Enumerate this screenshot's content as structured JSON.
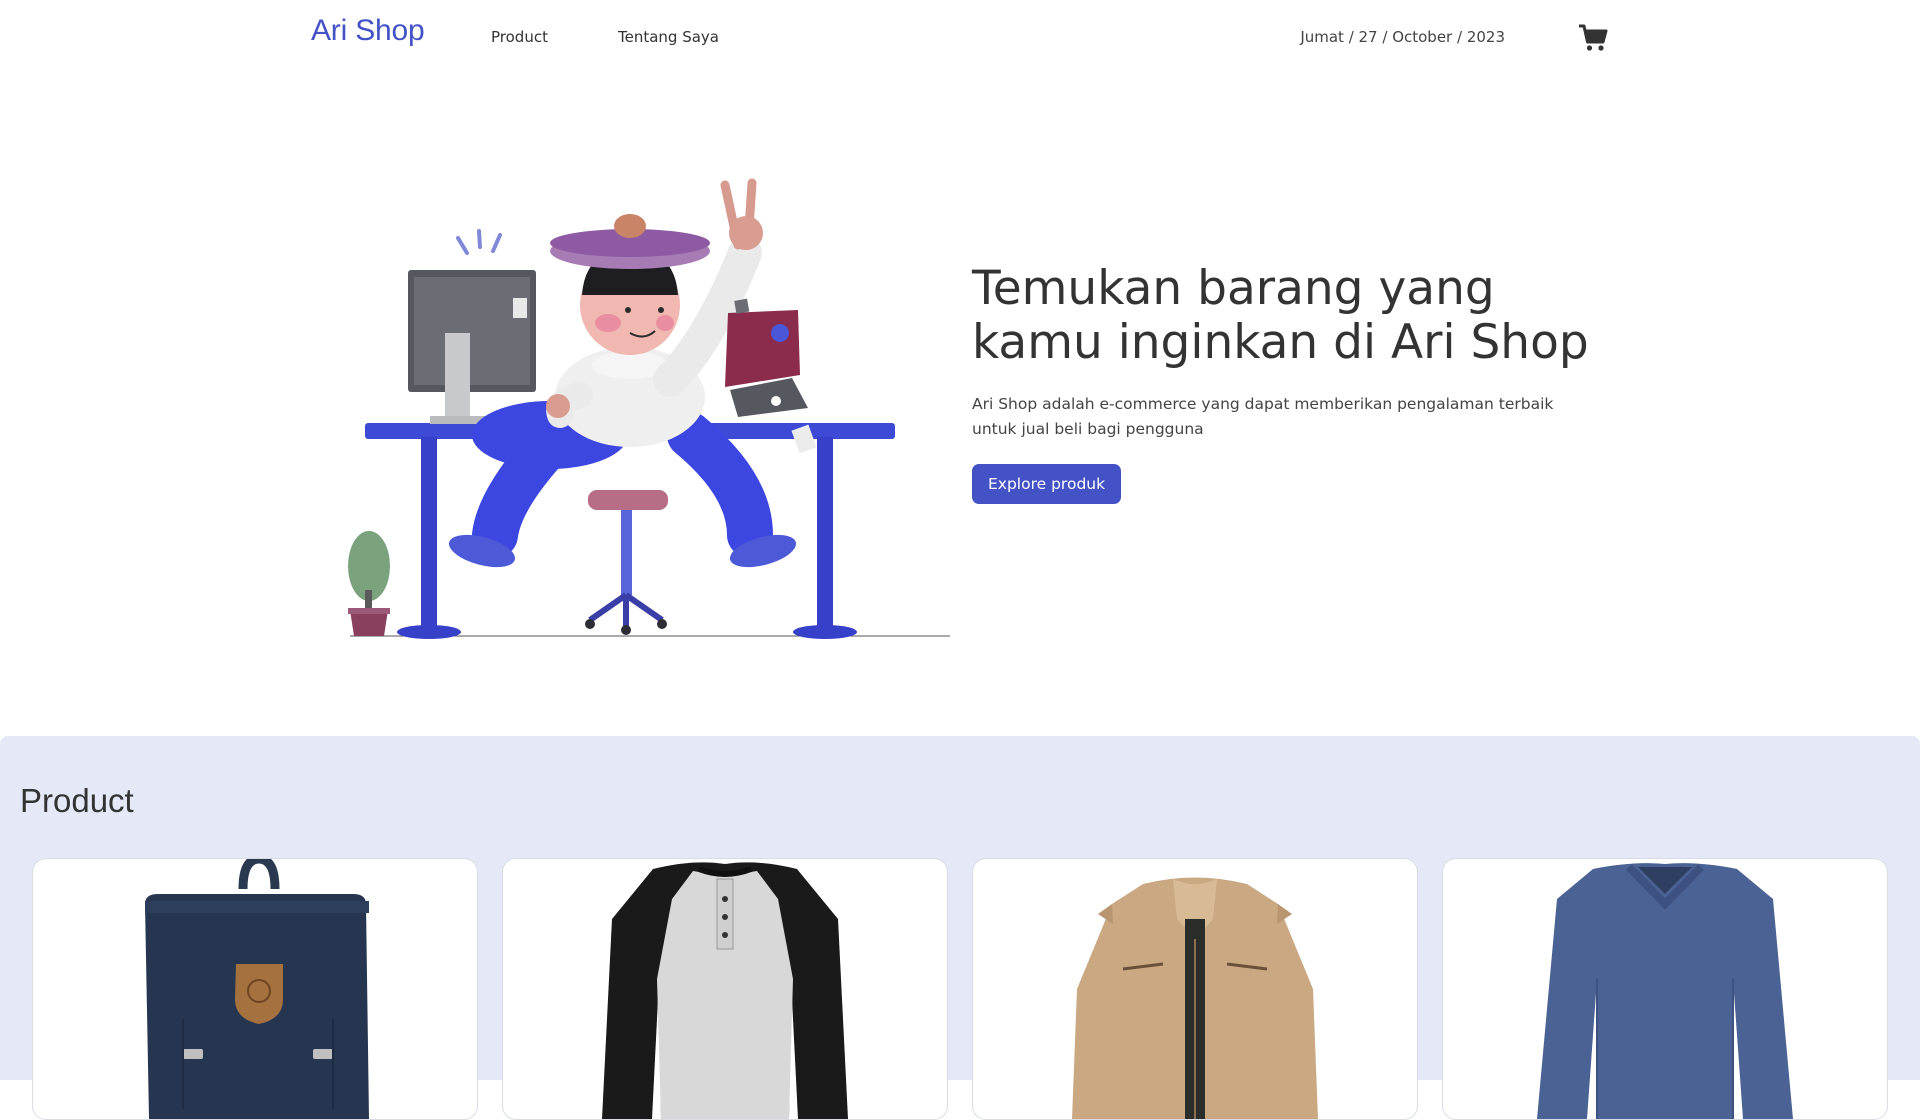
{
  "nav": {
    "brand": "Ari Shop",
    "links": [
      "Product",
      "Tentang Saya"
    ],
    "date": "Jumat / 27 / October / 2023",
    "cart_icon": "cart-icon"
  },
  "hero": {
    "title": "Temukan barang yang kamu inginkan di Ari Shop",
    "description": "Ari Shop adalah e-commerce yang dapat memberikan pengalaman terbaik untuk jual beli bagi pengguna",
    "button_label": "Explore produk",
    "illustration": "person-at-desk-illustration"
  },
  "products": {
    "title": "Product",
    "items": [
      {
        "image": "backpack-image"
      },
      {
        "image": "raglan-shirt-image"
      },
      {
        "image": "jacket-image"
      },
      {
        "image": "sweater-image"
      }
    ]
  },
  "colors": {
    "accent": "#4353c6",
    "section_bg": "#e5e9f7"
  }
}
